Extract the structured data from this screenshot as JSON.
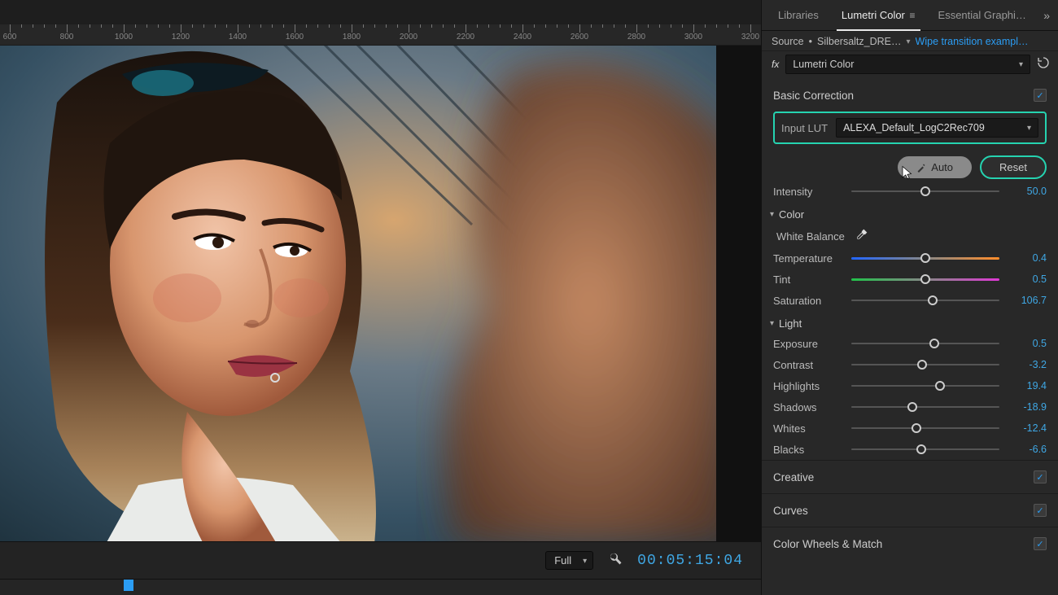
{
  "ruler": {
    "start": 600,
    "step": 200,
    "count": 14
  },
  "playback": {
    "resolution": "Full",
    "timecode": "00:05:15:04"
  },
  "tabs": {
    "libraries": "Libraries",
    "lumetri": "Lumetri Color",
    "essential": "Essential Graphi…"
  },
  "source": {
    "prefix": "Source",
    "clip": "Silbersaltz_DRE…",
    "link": "Wipe transition exampl…"
  },
  "fx": {
    "label": "fx",
    "name": "Lumetri Color"
  },
  "basic": {
    "title": "Basic Correction",
    "inputLutLabel": "Input LUT",
    "inputLut": "ALEXA_Default_LogC2Rec709",
    "auto": "Auto",
    "reset": "Reset",
    "intensity": {
      "label": "Intensity",
      "value": "50.0",
      "pos": 50
    }
  },
  "color": {
    "title": "Color",
    "wb": "White Balance",
    "temperature": {
      "label": "Temperature",
      "value": "0.4",
      "pos": 50
    },
    "tint": {
      "label": "Tint",
      "value": "0.5",
      "pos": 50
    },
    "saturation": {
      "label": "Saturation",
      "value": "106.7",
      "pos": 55
    }
  },
  "light": {
    "title": "Light",
    "exposure": {
      "label": "Exposure",
      "value": "0.5",
      "pos": 56
    },
    "contrast": {
      "label": "Contrast",
      "value": "-3.2",
      "pos": 48
    },
    "highlights": {
      "label": "Highlights",
      "value": "19.4",
      "pos": 60
    },
    "shadows": {
      "label": "Shadows",
      "value": "-18.9",
      "pos": 41
    },
    "whites": {
      "label": "Whites",
      "value": "-12.4",
      "pos": 44
    },
    "blacks": {
      "label": "Blacks",
      "value": "-6.6",
      "pos": 47
    }
  },
  "sections": {
    "creative": "Creative",
    "curves": "Curves",
    "wheels": "Color Wheels & Match"
  }
}
